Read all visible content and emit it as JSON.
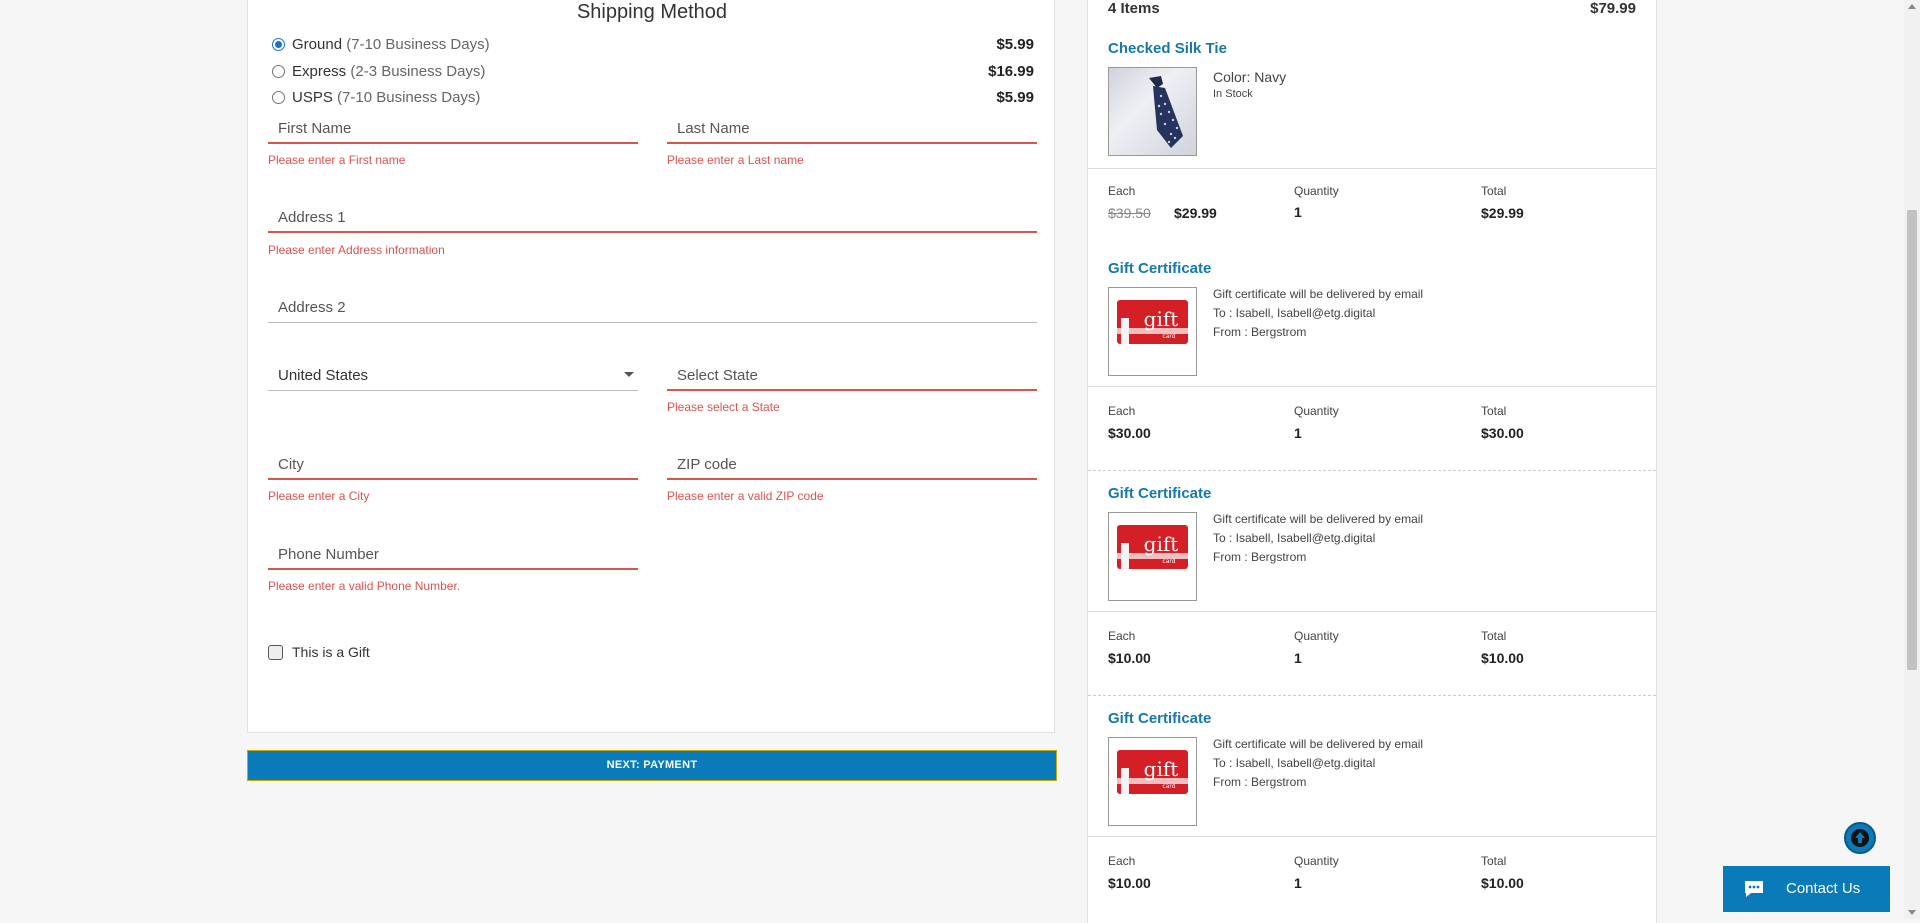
{
  "shipping": {
    "title": "Shipping Method",
    "options": [
      {
        "name": "Ground",
        "detail": "(7-10 Business Days)",
        "price": "$5.99",
        "selected": true
      },
      {
        "name": "Express",
        "detail": "(2-3 Business Days)",
        "price": "$16.99",
        "selected": false
      },
      {
        "name": "USPS",
        "detail": "(7-10 Business Days)",
        "price": "$5.99",
        "selected": false
      }
    ]
  },
  "form": {
    "first_name": {
      "placeholder": "First Name",
      "error": "Please enter a First name"
    },
    "last_name": {
      "placeholder": "Last Name",
      "error": "Please enter a Last name"
    },
    "address1": {
      "placeholder": "Address 1",
      "error": "Please enter Address information"
    },
    "address2": {
      "placeholder": "Address 2"
    },
    "country": {
      "value": "United States"
    },
    "state": {
      "placeholder": "Select State",
      "error": "Please select a State"
    },
    "city": {
      "placeholder": "City",
      "error": "Please enter a City"
    },
    "zip": {
      "placeholder": "ZIP code",
      "error": "Please enter a valid ZIP code"
    },
    "phone": {
      "placeholder": "Phone Number",
      "error": "Please enter a valid Phone Number."
    },
    "gift_label": "This is a Gift"
  },
  "next_button": "NEXT: PAYMENT",
  "summary": {
    "count": "4 Items",
    "total": "$79.99",
    "col_each": "Each",
    "col_quantity": "Quantity",
    "col_total": "Total",
    "items": [
      {
        "title": "Checked Silk Tie",
        "color": "Color: Navy",
        "stock": "In Stock",
        "orig_price": "$39.50",
        "each": "$29.99",
        "qty": "1",
        "total": "$29.99"
      },
      {
        "title": "Gift Certificate",
        "line1": "Gift certificate will be delivered by email",
        "line2": "To : Isabell, Isabell@etg.digital",
        "line3": "From : Bergstrom",
        "each": "$30.00",
        "qty": "1",
        "total": "$30.00"
      },
      {
        "title": "Gift Certificate",
        "line1": "Gift certificate will be delivered by email",
        "line2": "To : Isabell, Isabell@etg.digital",
        "line3": "From : Bergstrom",
        "each": "$10.00",
        "qty": "1",
        "total": "$10.00"
      },
      {
        "title": "Gift Certificate",
        "line1": "Gift certificate will be delivered by email",
        "line2": "To : Isabell, Isabell@etg.digital",
        "line3": "From : Bergstrom",
        "each": "$10.00",
        "qty": "1",
        "total": "$10.00"
      }
    ]
  },
  "gift_card_text": "gift",
  "gift_card_subtext": "card",
  "contact_label": "Contact Us",
  "colors": {
    "accent": "#0a7ab8",
    "link": "#1679a8",
    "error": "#d9534f"
  }
}
